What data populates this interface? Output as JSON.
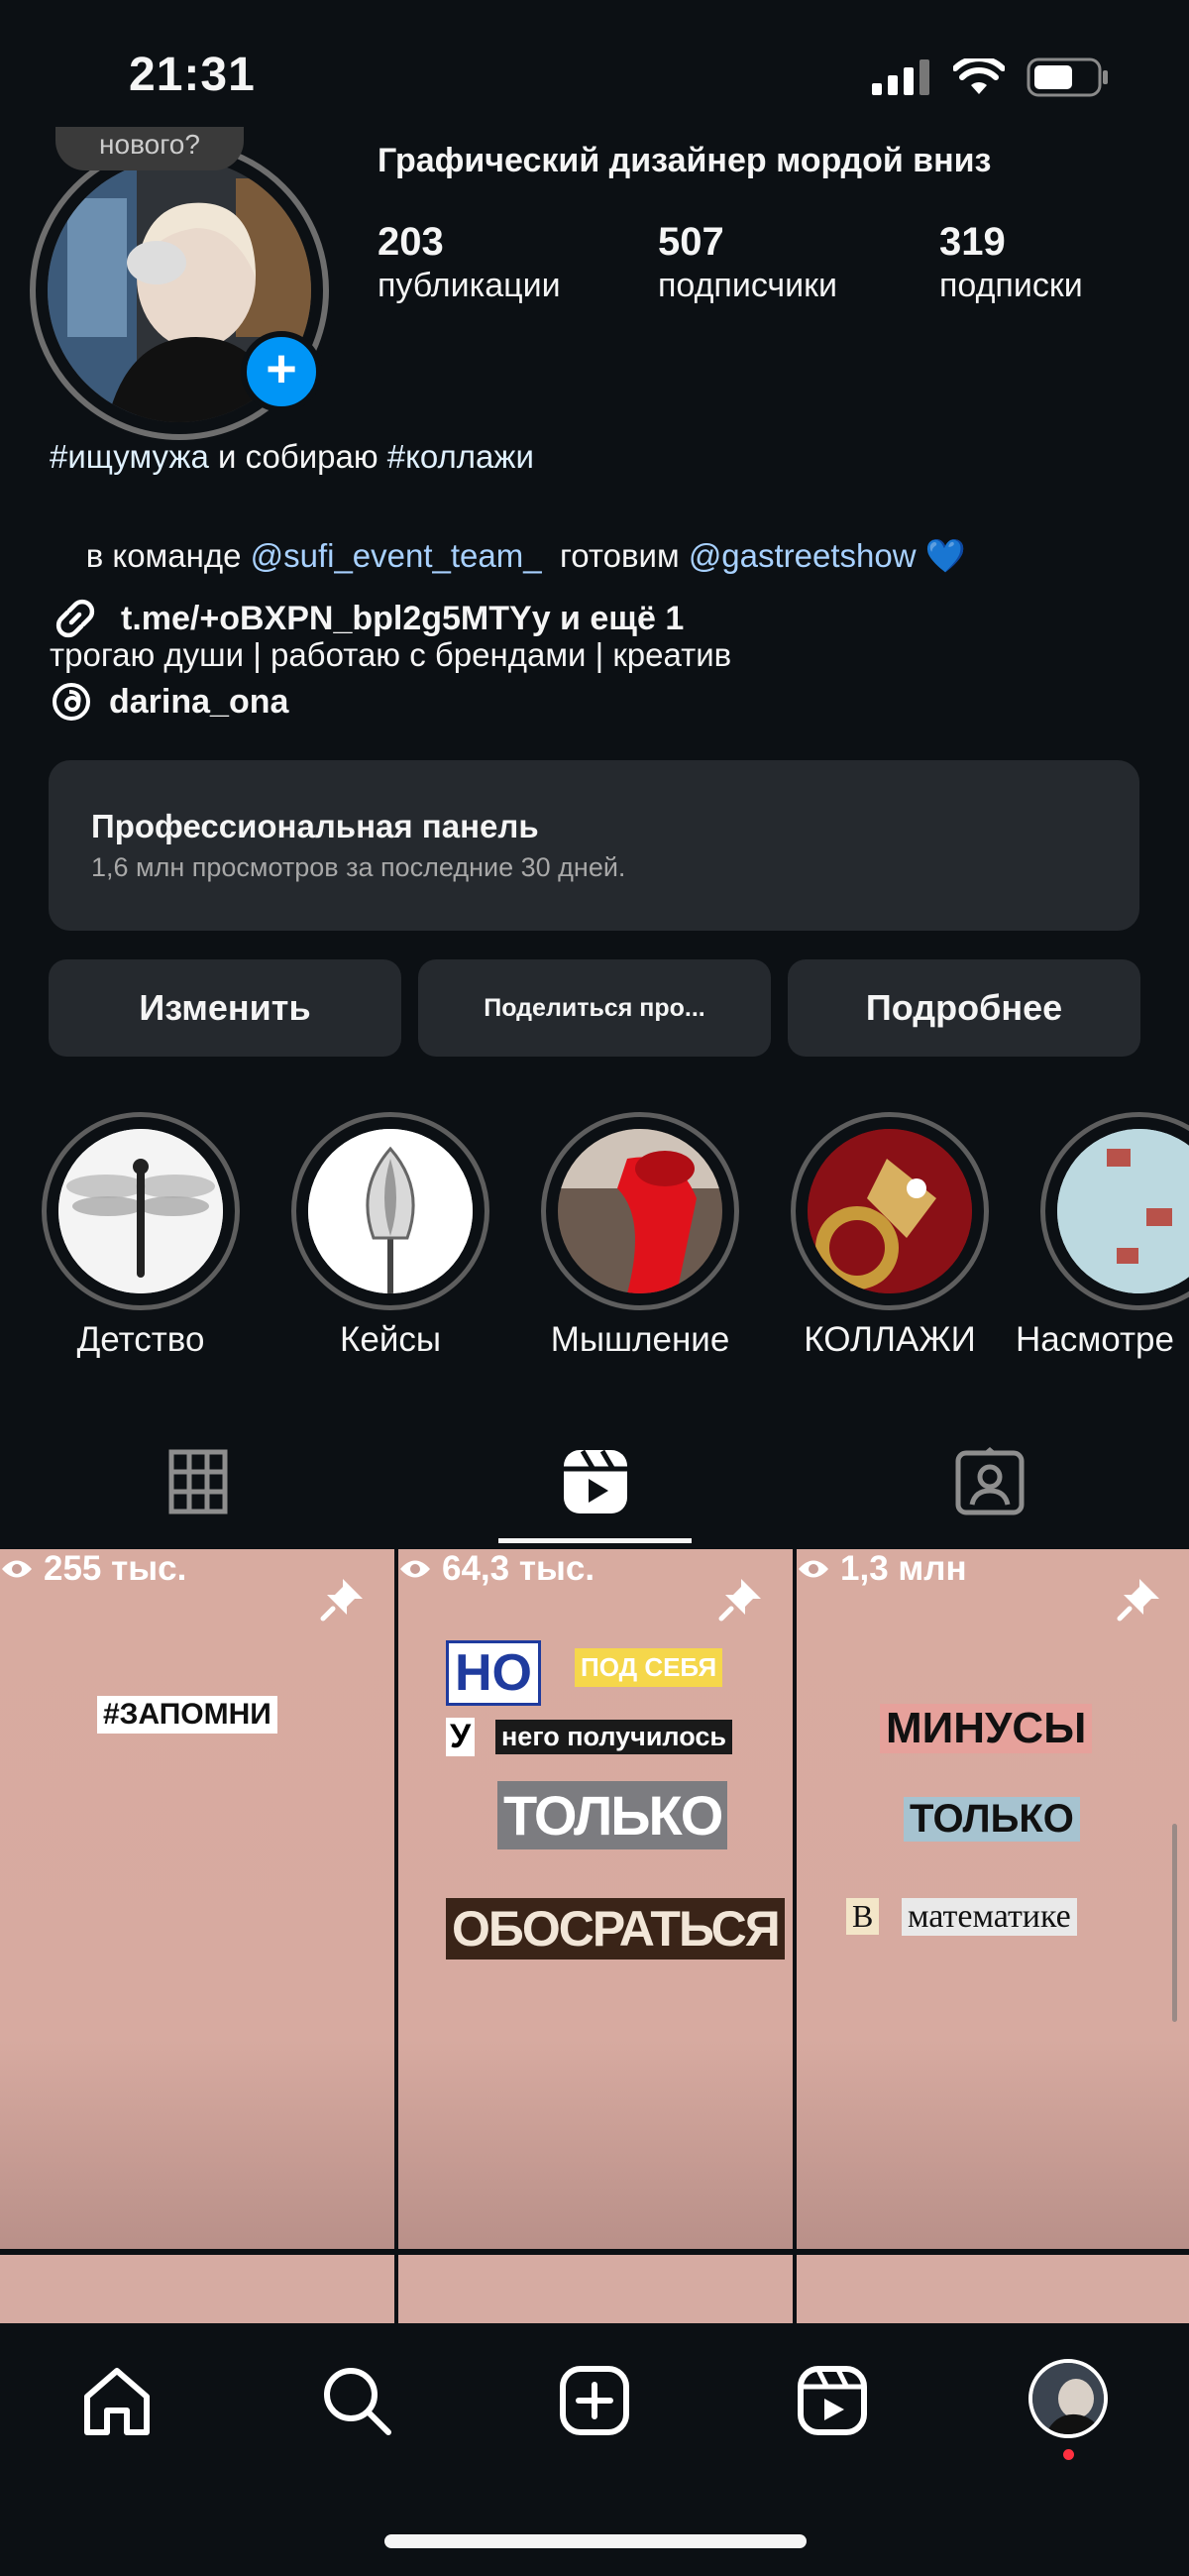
{
  "status": {
    "time": "21:31"
  },
  "profile": {
    "note": "нового?",
    "name": "Графический дизайнер мордой вниз",
    "stats": [
      {
        "count": "203",
        "label": "публикации"
      },
      {
        "count": "507",
        "label": "подписчики"
      },
      {
        "count": "319",
        "label": "подписки"
      }
    ],
    "bio": {
      "line1_tag1": "#ищумужа",
      "line1_text": " и собираю ",
      "line1_tag2": "#коллажи",
      "line2_text1": "в команде ",
      "line2_mention1": "@sufi_event_team_",
      "line2_text2": "  готовим ",
      "line2_mention2": "@gastreetshow",
      "line2_emoji": "💙",
      "line3": "трогаю души | работаю с брендами | креатив"
    },
    "link": "t.me/+oBXPN_bpl2g5MTYy и ещё 1",
    "threads": "darina_ona"
  },
  "pro_panel": {
    "title": "Профессиональная панель",
    "subtitle": "1,6 млн просмотров за последние 30 дней."
  },
  "buttons": {
    "edit": "Изменить",
    "share": "Поделиться про...",
    "more": "Подробнее"
  },
  "highlights": [
    {
      "label": "Детство"
    },
    {
      "label": "Кейсы"
    },
    {
      "label": "Мышление"
    },
    {
      "label": "КОЛЛАЖИ"
    },
    {
      "label": "Насмотре"
    }
  ],
  "posts": [
    {
      "words": [
        "#ЗАПОМНИ"
      ],
      "views": "255 тыс."
    },
    {
      "words": [
        "НО",
        "ПОД СЕБЯ",
        "У",
        "него получилось",
        "ТОЛЬКО",
        "ОБОСРАТЬСЯ"
      ],
      "views": "64,3 тыс."
    },
    {
      "words": [
        "МИНУСЫ",
        "ТОЛЬКО",
        "В",
        "математике"
      ],
      "views": "1,3 млн"
    }
  ],
  "icons": {
    "grid": "grid-icon",
    "reels": "reels-icon",
    "tagged": "tagged-icon",
    "home": "home-icon",
    "search": "search-icon",
    "create": "create-icon",
    "reels_nav": "reels-nav-icon",
    "profile": "profile-avatar"
  },
  "colors": {
    "background": "#0c1014",
    "panel": "#25292e",
    "accent": "#0095f6",
    "post_bg": "#d8aba0",
    "notification": "#ff3040"
  }
}
